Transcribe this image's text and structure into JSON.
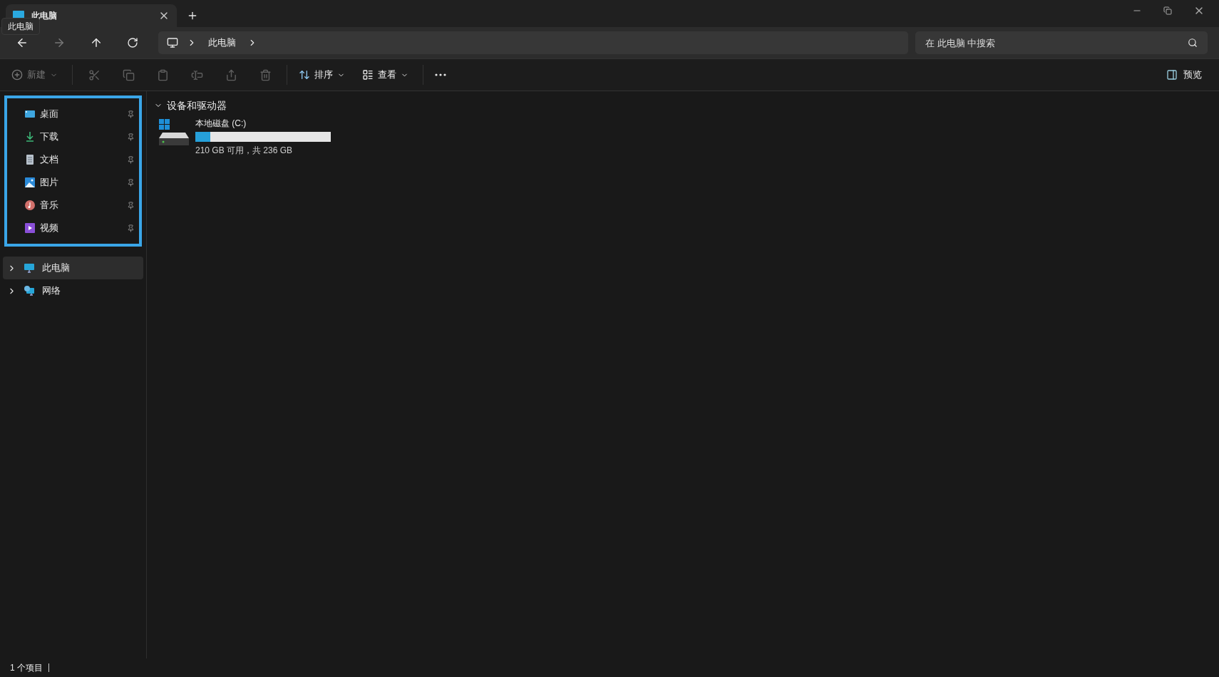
{
  "tab": {
    "title": "此电脑",
    "selected": true
  },
  "tooltip": "此电脑",
  "address": {
    "segments": [
      "此电脑"
    ]
  },
  "search": {
    "placeholder": "在 此电脑 中搜索"
  },
  "toolbar": {
    "new": {
      "label": "新建",
      "disabled": true
    },
    "actions": [
      {
        "kind": "cut",
        "disabled": true
      },
      {
        "kind": "copy",
        "disabled": true
      },
      {
        "kind": "paste",
        "disabled": true
      },
      {
        "kind": "rename",
        "disabled": true
      },
      {
        "kind": "share",
        "disabled": true
      },
      {
        "kind": "delete",
        "disabled": true
      }
    ],
    "sort": "排序",
    "view": "查看"
  },
  "preview": "预览",
  "sidebar": {
    "quick_access": [
      {
        "label": "桌面",
        "kind": "desktop",
        "pinned": true
      },
      {
        "label": "下载",
        "kind": "downloads",
        "pinned": true
      },
      {
        "label": "文档",
        "kind": "documents",
        "pinned": true
      },
      {
        "label": "图片",
        "kind": "pictures",
        "pinned": true
      },
      {
        "label": "音乐",
        "kind": "music",
        "pinned": true
      },
      {
        "label": "视频",
        "kind": "videos",
        "pinned": true
      }
    ],
    "roots": [
      {
        "label": "此电脑",
        "kind": "pc",
        "selected": true,
        "expanded": false
      },
      {
        "label": "网络",
        "kind": "network",
        "selected": false,
        "expanded": false
      }
    ]
  },
  "section": {
    "title": "设备和驱动器",
    "expanded": true
  },
  "drives": [
    {
      "name": "本地磁盘 (C:)",
      "level": 0.11,
      "info": "210 GB 可用，共 236 GB"
    }
  ],
  "status_bar": {
    "count": "1 个项目"
  }
}
